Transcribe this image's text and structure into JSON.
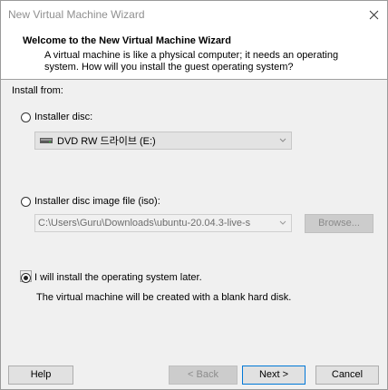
{
  "window": {
    "title": "New Virtual Machine Wizard"
  },
  "header": {
    "title": "Welcome to the New Virtual Machine Wizard",
    "description": "A virtual machine is like a physical computer; it needs an operating system. How will you install the guest operating system?"
  },
  "install_from": {
    "label": "Install from:",
    "options": [
      {
        "label": "Installer disc:",
        "selected": false
      },
      {
        "label": "Installer disc image file (iso):",
        "selected": false
      },
      {
        "label": "I will install the operating system later.",
        "selected": true
      }
    ],
    "disc_drive": {
      "value": "DVD RW 드라이브 (E:)",
      "icon": "dvd-drive-icon"
    },
    "iso_path": {
      "value": "C:\\Users\\Guru\\Downloads\\ubuntu-20.04.3-live-s"
    },
    "browse_label": "Browse...",
    "later_description": "The virtual machine will be created with a blank hard disk."
  },
  "footer": {
    "help": "Help",
    "back": "< Back",
    "next": "Next >",
    "cancel": "Cancel"
  },
  "colors": {
    "content_bg": "#f0f0f0",
    "disabled_button_bg": "#cccccc",
    "primary_border": "#0078d7"
  }
}
